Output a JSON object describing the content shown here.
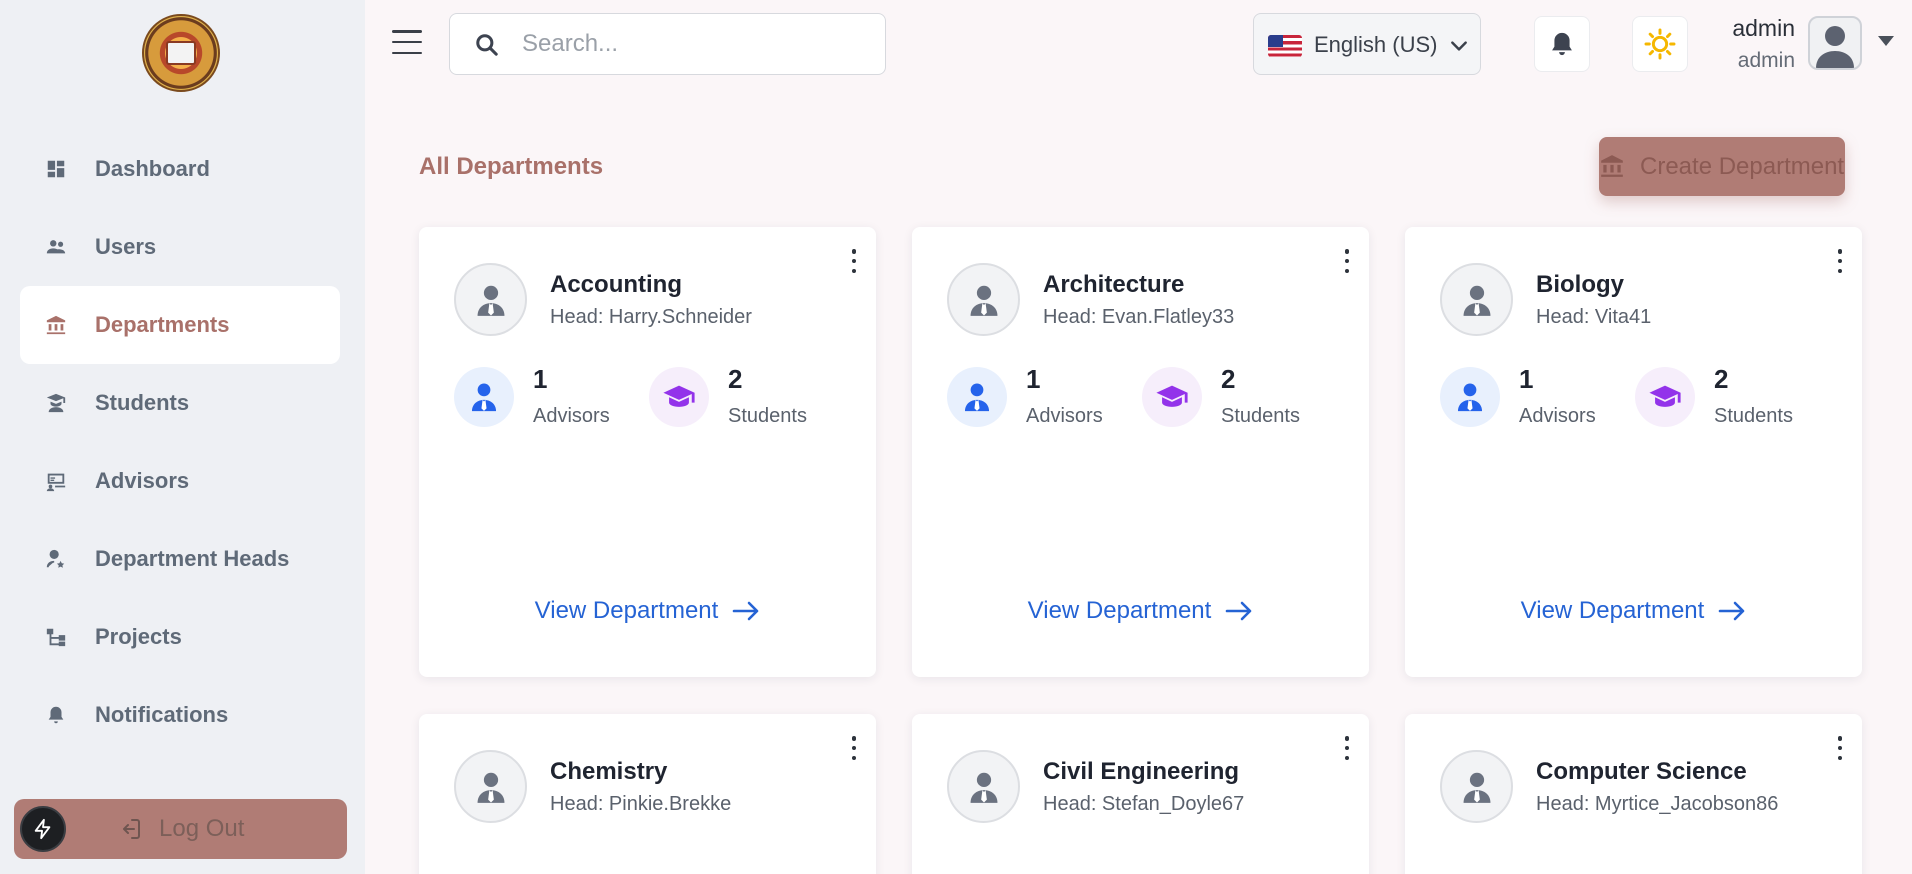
{
  "sidebar": {
    "items": [
      {
        "label": "Dashboard",
        "icon": "dashboard-icon",
        "active": false
      },
      {
        "label": "Users",
        "icon": "users-icon",
        "active": false
      },
      {
        "label": "Departments",
        "icon": "institution-icon",
        "active": true
      },
      {
        "label": "Students",
        "icon": "student-icon",
        "active": false
      },
      {
        "label": "Advisors",
        "icon": "advisor-icon",
        "active": false
      },
      {
        "label": "Department Heads",
        "icon": "person-star-icon",
        "active": false
      },
      {
        "label": "Projects",
        "icon": "projects-icon",
        "active": false
      },
      {
        "label": "Notifications",
        "icon": "bell-icon",
        "active": false
      }
    ],
    "logout_label": "Log Out"
  },
  "header": {
    "search_placeholder": "Search...",
    "language": "English (US)",
    "user_name": "admin",
    "user_role": "admin"
  },
  "main": {
    "title": "All Departments",
    "create_button": "Create Department",
    "view_label": "View Department",
    "advisors_label": "Advisors",
    "students_label": "Students",
    "departments": [
      {
        "name": "Accounting",
        "head": "Head: Harry.Schneider",
        "advisors": "1",
        "students": "2"
      },
      {
        "name": "Architecture",
        "head": "Head: Evan.Flatley33",
        "advisors": "1",
        "students": "2"
      },
      {
        "name": "Biology",
        "head": "Head: Vita41",
        "advisors": "1",
        "students": "2"
      },
      {
        "name": "Chemistry",
        "head": "Head: Pinkie.Brekke"
      },
      {
        "name": "Civil Engineering",
        "head": "Head: Stefan_Doyle67"
      },
      {
        "name": "Computer Science",
        "head": "Head: Myrtice_Jacobson86"
      }
    ]
  },
  "colors": {
    "accent": "#a9716a",
    "button": "#b07c75",
    "link": "#2563d4",
    "advisor_icon": "#2563eb",
    "student_icon": "#9333ea",
    "sun_icon": "#f5b700"
  }
}
